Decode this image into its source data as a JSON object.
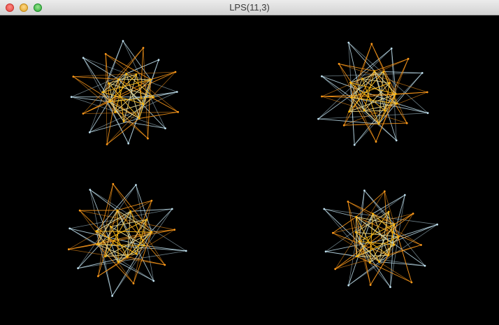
{
  "window": {
    "title": "LPS(11,3)"
  },
  "colors": {
    "background": "#000000",
    "edge_light": "#bfe0ef",
    "edge_orange": "#ff9a1a",
    "edge_gold": "#ffb400"
  },
  "icons": {
    "close": "close-dot",
    "minimize": "minimize-dot",
    "zoom": "zoom-dot"
  }
}
